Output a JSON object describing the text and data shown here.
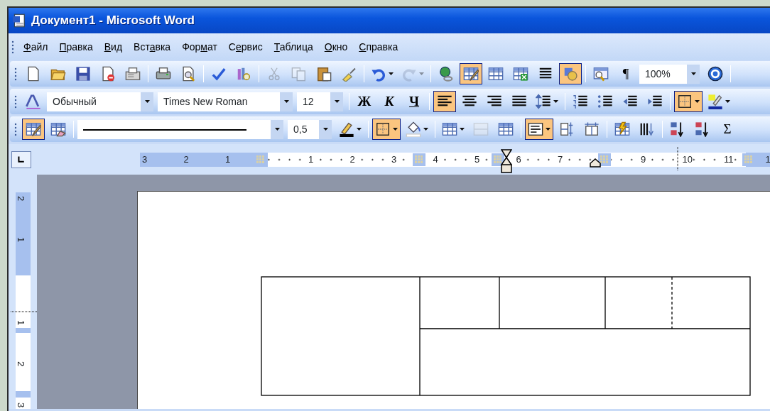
{
  "window": {
    "title": "Документ1 - Microsoft Word"
  },
  "menu": [
    {
      "key": "Ф",
      "after": "айл"
    },
    {
      "key": "П",
      "after": "равка"
    },
    {
      "key": "В",
      "after": "ид"
    },
    {
      "before": "Вст",
      "key": "а",
      "after": "вка"
    },
    {
      "before": "Фор",
      "key": "м",
      "after": "ат"
    },
    {
      "before": "С",
      "key": "е",
      "after": "рвис"
    },
    {
      "key": "Т",
      "after": "аблица"
    },
    {
      "key": "О",
      "after": "кно"
    },
    {
      "key": "С",
      "after": "правка"
    }
  ],
  "toolbars": [
    {
      "items": [
        {
          "kind": "button",
          "on": false,
          "disabled": false
        },
        {
          "kind": "button",
          "on": false,
          "disabled": false
        },
        {
          "kind": "button",
          "on": false,
          "disabled": false
        },
        {
          "kind": "button",
          "on": false,
          "disabled": false
        },
        {
          "kind": "button",
          "on": false,
          "disabled": false
        },
        {
          "kind": "separator"
        },
        {
          "kind": "button",
          "on": false,
          "disabled": false
        },
        {
          "kind": "button",
          "on": false,
          "disabled": false
        },
        {
          "kind": "separator"
        },
        {
          "kind": "button",
          "on": false,
          "disabled": false
        },
        {
          "kind": "button",
          "on": false,
          "disabled": false
        },
        {
          "kind": "separator"
        },
        {
          "kind": "button",
          "on": false,
          "disabled": true
        },
        {
          "kind": "button",
          "on": false,
          "disabled": true
        },
        {
          "kind": "button",
          "on": false,
          "disabled": false
        },
        {
          "kind": "button",
          "on": false,
          "disabled": false
        },
        {
          "kind": "separator"
        },
        {
          "kind": "split",
          "on": false,
          "disabled": false
        },
        {
          "kind": "split",
          "on": false,
          "disabled": true
        },
        {
          "kind": "separator"
        },
        {
          "kind": "button",
          "on": false,
          "disabled": false
        },
        {
          "kind": "button",
          "on": true,
          "disabled": false
        },
        {
          "kind": "button",
          "on": false,
          "disabled": false
        },
        {
          "kind": "button",
          "on": false,
          "disabled": false
        },
        {
          "kind": "button",
          "on": false,
          "disabled": false
        },
        {
          "kind": "button",
          "on": true,
          "disabled": false
        },
        {
          "kind": "separator"
        },
        {
          "kind": "button",
          "on": false,
          "disabled": false
        },
        {
          "kind": "text",
          "label": "¶",
          "on": false
        },
        {
          "kind": "combo",
          "value": "100%"
        },
        {
          "kind": "button",
          "on": false,
          "disabled": false
        },
        {
          "kind": "separator"
        }
      ]
    },
    {
      "items": [
        {
          "kind": "button",
          "on": false,
          "disabled": false
        },
        {
          "kind": "combo",
          "value": "Обычный"
        },
        {
          "kind": "combo",
          "value": "Times New Roman"
        },
        {
          "kind": "combo",
          "value": "12"
        },
        {
          "kind": "separator"
        },
        {
          "kind": "text",
          "label": "Ж",
          "on": false
        },
        {
          "kind": "text",
          "label": "К",
          "on": false
        },
        {
          "kind": "text",
          "label": "Ч",
          "on": false
        },
        {
          "kind": "separator"
        },
        {
          "kind": "button",
          "on": true,
          "disabled": false
        },
        {
          "kind": "button",
          "on": false,
          "disabled": false
        },
        {
          "kind": "button",
          "on": false,
          "disabled": false
        },
        {
          "kind": "button",
          "on": false,
          "disabled": false
        },
        {
          "kind": "split",
          "on": false,
          "disabled": false
        },
        {
          "kind": "separator"
        },
        {
          "kind": "button",
          "on": false,
          "disabled": false
        },
        {
          "kind": "button",
          "on": false,
          "disabled": false
        },
        {
          "kind": "button",
          "on": false,
          "disabled": false
        },
        {
          "kind": "button",
          "on": false,
          "disabled": false
        },
        {
          "kind": "separator"
        },
        {
          "kind": "split",
          "on": true,
          "disabled": false
        },
        {
          "kind": "split",
          "on": false,
          "disabled": false
        }
      ]
    },
    {
      "items": [
        {
          "kind": "button",
          "on": true,
          "disabled": false
        },
        {
          "kind": "button",
          "on": false,
          "disabled": false
        },
        {
          "kind": "separator"
        },
        {
          "kind": "line-combo"
        },
        {
          "kind": "combo",
          "value": "0,5"
        },
        {
          "kind": "split",
          "on": false,
          "disabled": false
        },
        {
          "kind": "separator"
        },
        {
          "kind": "split",
          "on": true,
          "disabled": false
        },
        {
          "kind": "split",
          "on": false,
          "disabled": false
        },
        {
          "kind": "separator"
        },
        {
          "kind": "split",
          "on": false,
          "disabled": false
        },
        {
          "kind": "button",
          "on": false,
          "disabled": true
        },
        {
          "kind": "button",
          "on": false,
          "disabled": false
        },
        {
          "kind": "separator"
        },
        {
          "kind": "split",
          "on": true,
          "disabled": false
        },
        {
          "kind": "button",
          "on": false,
          "disabled": false
        },
        {
          "kind": "button",
          "on": false,
          "disabled": false
        },
        {
          "kind": "separator"
        },
        {
          "kind": "button",
          "on": false,
          "disabled": false
        },
        {
          "kind": "button",
          "on": false,
          "disabled": false
        },
        {
          "kind": "separator"
        },
        {
          "kind": "button",
          "on": false,
          "disabled": false
        },
        {
          "kind": "button",
          "on": false,
          "disabled": false
        },
        {
          "kind": "text",
          "label": "Σ",
          "on": false
        }
      ]
    }
  ],
  "ruler": {
    "labels": [
      "3",
      "2",
      "1",
      "1",
      "2",
      "3",
      "4",
      "5",
      "6",
      "7",
      "9",
      "10",
      "11",
      "1"
    ]
  },
  "vertical_ruler": {
    "labels": [
      "2",
      "1",
      "1",
      "2",
      "3"
    ]
  }
}
